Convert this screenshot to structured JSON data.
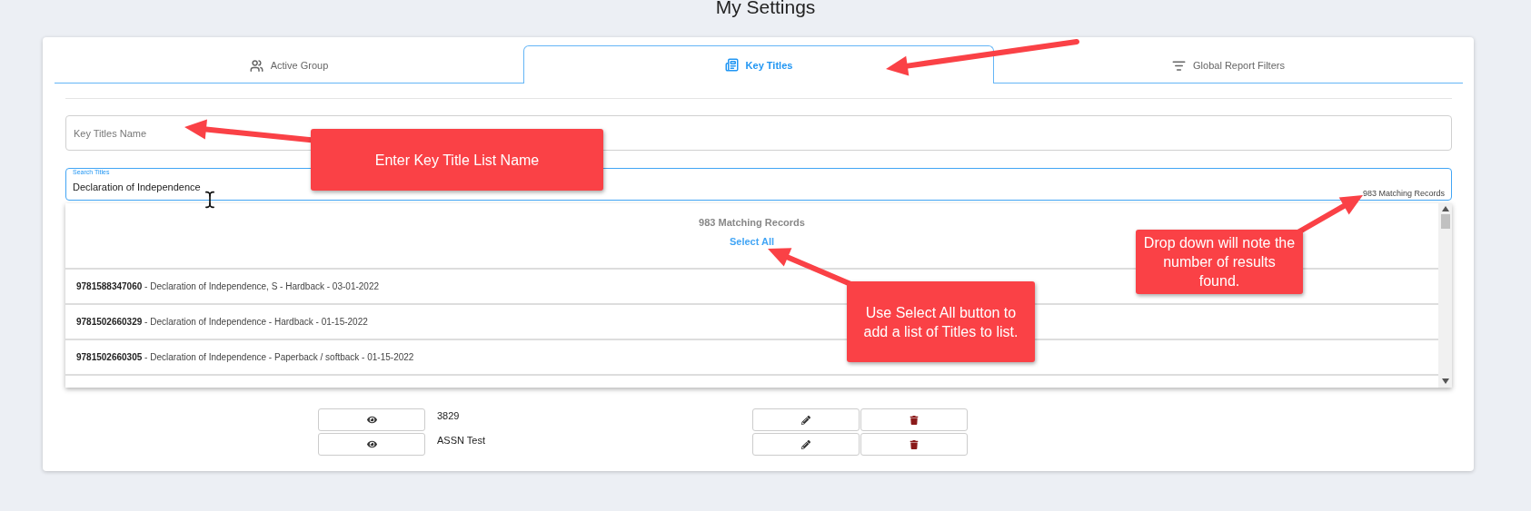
{
  "page_title": "My Settings",
  "tabs": [
    {
      "label": "Active Group",
      "selected": false
    },
    {
      "label": "Key Titles",
      "selected": true
    },
    {
      "label": "Global Report Filters",
      "selected": false
    }
  ],
  "name_field": {
    "placeholder": "Key Titles Name"
  },
  "search_field": {
    "label": "Search Titles",
    "value": "Declaration of Independence",
    "match_count": "983 Matching Records"
  },
  "dropdown": {
    "heading": "983 Matching Records",
    "select_all": "Select All",
    "rows": [
      {
        "isbn": "9781588347060",
        "description": " - Declaration of Independence, S - Hardback - 03-01-2022"
      },
      {
        "isbn": "9781502660329",
        "description": " - Declaration of Independence - Hardback - 01-15-2022"
      },
      {
        "isbn": "9781502660305",
        "description": " - Declaration of Independence - Paperback / softback - 01-15-2022"
      }
    ]
  },
  "saved_lists": [
    {
      "name": "3829"
    },
    {
      "name": "ASSN Test"
    }
  ],
  "callouts": [
    {
      "text": "Enter Key Title List Name"
    },
    {
      "text": "Use Select All button to add a list of Titles to list."
    },
    {
      "text": "Drop down will note the number of results found."
    }
  ]
}
